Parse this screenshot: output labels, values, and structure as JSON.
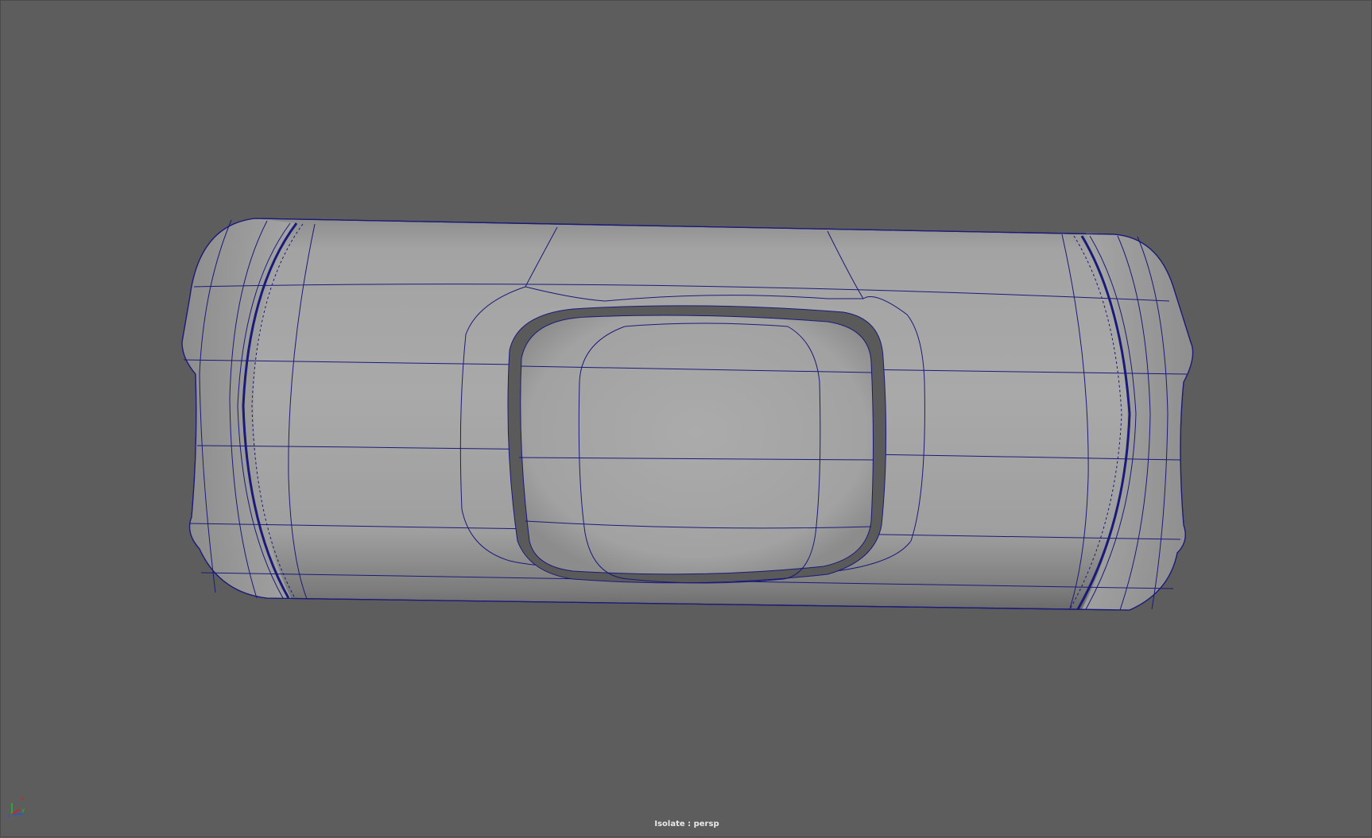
{
  "viewport": {
    "camera_label": "Isolate : persp",
    "background_color": "#5d5d5d",
    "wire_color": "#1a1a7a"
  },
  "axis_gizmo": {
    "labels": [
      "x",
      "y",
      "z"
    ],
    "colors": {
      "x": "#d02020",
      "y": "#20c020",
      "z": "#3050e0"
    }
  }
}
